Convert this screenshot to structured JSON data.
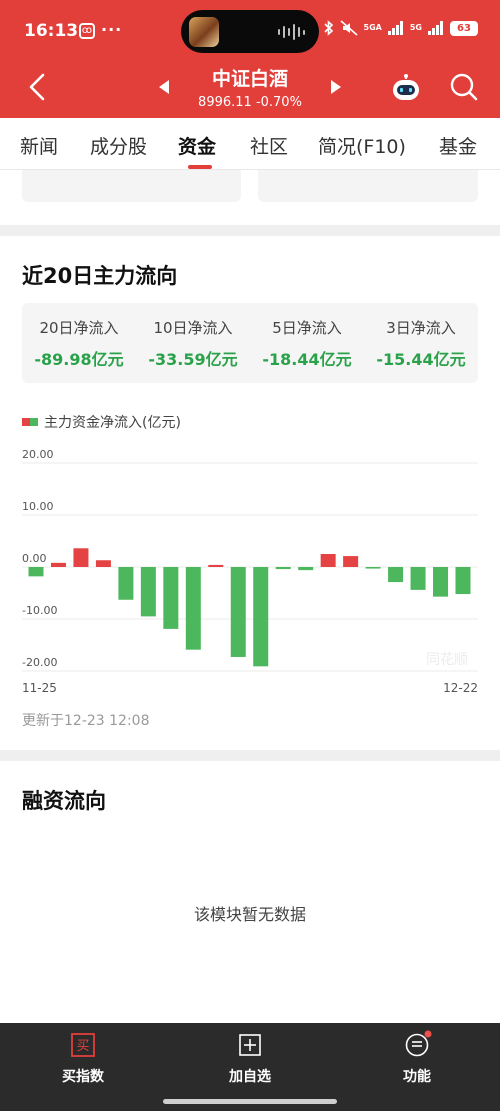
{
  "status_bar": {
    "time": "16:13",
    "dots": "···",
    "network_labels": [
      "5GA",
      "5G"
    ],
    "battery": "63"
  },
  "nav": {
    "title": "中证白酒",
    "subtitle": "8996.11 -0.70%",
    "back_icon": "chevron-left-icon",
    "prev_icon": "triangle-left-icon",
    "next_icon": "triangle-right-icon",
    "robot_icon": "robot-assistant-icon",
    "search_icon": "search-icon"
  },
  "tabs": [
    {
      "label": "新闻",
      "active": false
    },
    {
      "label": "成分股",
      "active": false
    },
    {
      "label": "资金",
      "active": true
    },
    {
      "label": "社区",
      "active": false
    },
    {
      "label": "简况(F10)",
      "active": false
    },
    {
      "label": "基金",
      "active": false
    }
  ],
  "flow_section": {
    "title": "近20日主力流向",
    "summary": [
      {
        "label": "20日净流入",
        "value": "-89.98亿元"
      },
      {
        "label": "10日净流入",
        "value": "-33.59亿元"
      },
      {
        "label": "5日净流入",
        "value": "-18.44亿元"
      },
      {
        "label": "3日净流入",
        "value": "-15.44亿元"
      }
    ],
    "legend_label": "主力资金净流入(亿元)",
    "updated": "更新于12-23 12:08"
  },
  "chart_data": {
    "type": "bar",
    "title": "",
    "ylabel": "主力资金净流入(亿元)",
    "ylim": [
      -20,
      20
    ],
    "ytick_labels": [
      "20.00",
      "10.00",
      "0.00",
      "-10.00",
      "-20.00"
    ],
    "x_start_label": "11-25",
    "x_end_label": "12-22",
    "values": [
      -1.8,
      0.8,
      3.6,
      1.3,
      -6.3,
      -9.5,
      -11.9,
      -15.9,
      0.4,
      -17.3,
      -19.1,
      -0.4,
      -0.6,
      2.5,
      2.1,
      -0.3,
      -2.9,
      -4.4,
      -5.7,
      -5.2
    ],
    "colors": {
      "positive": "#e54343",
      "negative": "#4cb75c"
    },
    "watermark": "同花顺",
    "grid": true
  },
  "rz_section": {
    "title": "融资流向",
    "empty_text": "该模块暂无数据"
  },
  "bottom_bar": {
    "buy_label": "买指数",
    "buy_glyph": "买",
    "add_label": "加自选",
    "func_label": "功能"
  },
  "colors": {
    "brand_red": "#e23f3b",
    "inflow_green": "#2aa24a"
  }
}
